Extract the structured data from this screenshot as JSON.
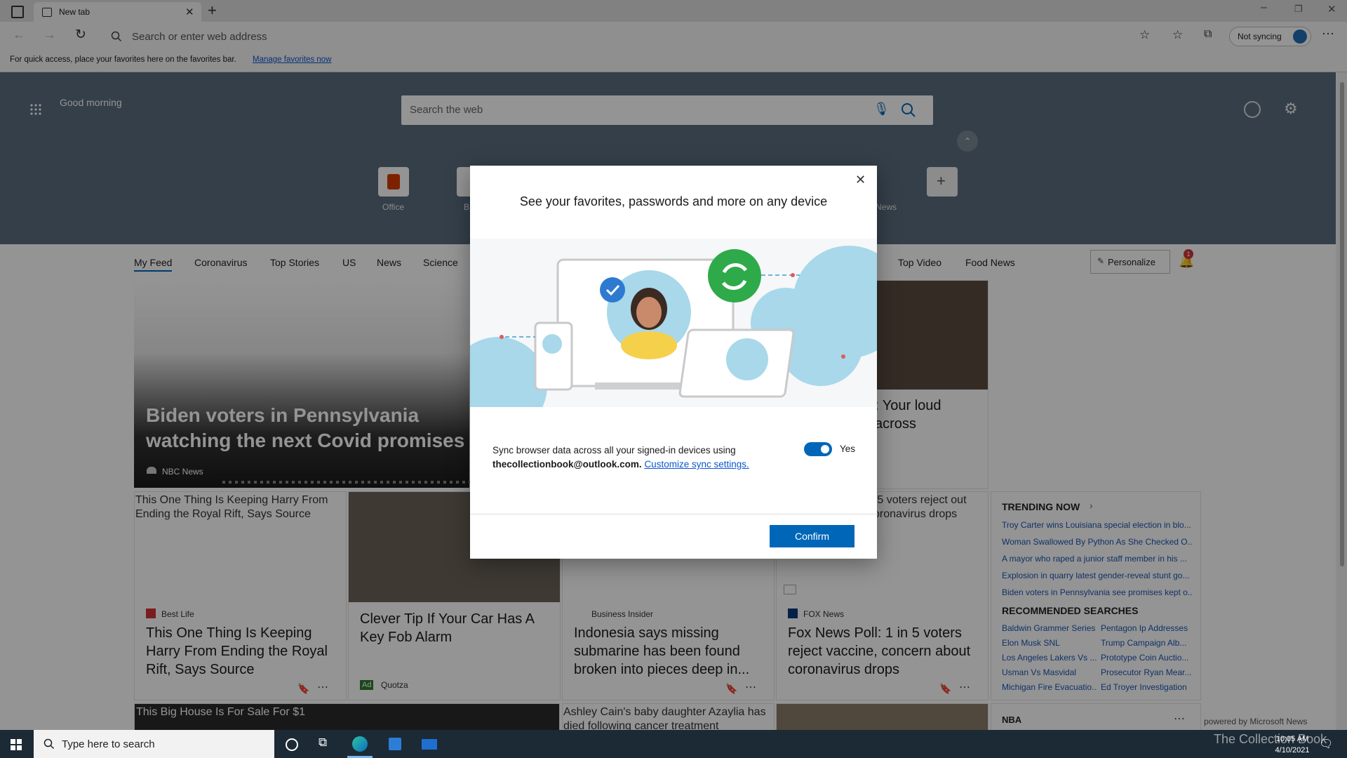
{
  "browser": {
    "tab_title": "New tab",
    "address_placeholder": "Search or enter web address",
    "sync_status": "Not syncing",
    "favorites_bar_message": "For quick access, place your favorites here on the favorites bar.",
    "favorites_bar_link": "Manage favorites now"
  },
  "newtab": {
    "greeting": "Good morning",
    "search_placeholder": "Search the web",
    "tiles": [
      {
        "label": "Office"
      },
      {
        "label": "B"
      },
      {
        "label": "News"
      }
    ],
    "nav_tabs": [
      "My Feed",
      "Coronavirus",
      "Top Stories",
      "US",
      "News",
      "Science",
      "Top Video",
      "Food News"
    ],
    "personalize_label": "Personalize",
    "notification_count": "1"
  },
  "feed": {
    "hero": {
      "title": "Biden voters in Pennsylvania watching the next Covid promises",
      "source": "NBC News"
    },
    "right_top": {
      "title_part": ": Your loud across"
    },
    "cards": [
      {
        "alt": "This One Thing Is Keeping Harry From Ending the Royal Rift, Says Source",
        "source": "Best Life",
        "title": "This One Thing Is Keeping Harry From Ending the Royal Rift, Says Source"
      },
      {
        "source": "Quotza",
        "ad": "Ad",
        "title": "Clever Tip If Your Car Has A Key Fob Alarm"
      },
      {
        "source": "Business Insider",
        "title": "Indonesia says missing submarine has been found broken into pieces deep in..."
      },
      {
        "alt": "n 5 voters reject out coronavirus drops",
        "source": "FOX News",
        "title": "Fox News Poll: 1 in 5 voters reject vaccine, concern about coronavirus drops"
      }
    ],
    "bottom_alts": [
      "This Big House Is For Sale For $1",
      "Ashley Cain's baby daughter Azaylia has died following cancer treatment"
    ],
    "trending_heading": "TRENDING NOW",
    "trending": [
      "Troy Carter wins Louisiana special election in blo...",
      "Woman Swallowed By Python As She Checked O...",
      "A mayor who raped a junior staff member in his ...",
      "Explosion in quarry latest gender-reveal stunt go...",
      "Biden voters in Pennsylvania see promises kept o..."
    ],
    "recommended_heading": "RECOMMENDED SEARCHES",
    "recommended_left": [
      "Baldwin Grammer Series",
      "Elon Musk SNL",
      "Los Angeles Lakers Vs ...",
      "Usman Vs Masvidal",
      "Michigan Fire Evacuatio..."
    ],
    "recommended_right": [
      "Pentagon Ip Addresses",
      "Trump Campaign Alb...",
      "Prototype Coin Auctio...",
      "Prosecutor Ryan Mear...",
      "Ed Troyer Investigation"
    ],
    "nba_label": "NBA",
    "powered_by": "powered by Microsoft News"
  },
  "modal": {
    "title": "See your favorites, passwords and more on any device",
    "sync_text": "Sync browser data across all your signed-in devices using",
    "email": "thecollectionbook@outlook.com.",
    "customize_link": "Customize sync settings.",
    "toggle_label": "Yes",
    "confirm_label": "Confirm"
  },
  "taskbar": {
    "search_placeholder": "Type here to search",
    "time": "10:05 AM",
    "date": "4/10/2021",
    "watermark": "The Collection Book"
  }
}
